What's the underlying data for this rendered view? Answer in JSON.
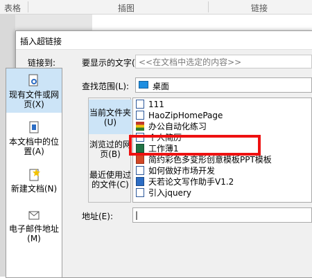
{
  "header": {
    "col1": "表格",
    "col2": "插图",
    "col3": "链接"
  },
  "dialog": {
    "title": "插入超链接",
    "link_to_label": "链接到:",
    "display_text_label": "要显示的文字(T):",
    "display_text_value": "<<在文档中选定的内容>>",
    "look_in_label": "查找范围(L):",
    "look_in_value": "桌面",
    "address_label": "地址(E):",
    "address_value": "|"
  },
  "left_panel": {
    "items": [
      {
        "label": "现有文件或网页(X)"
      },
      {
        "label": "本文档中的位置(A)"
      },
      {
        "label": "新建文档(N)"
      },
      {
        "label": "电子邮件地址(M)"
      }
    ]
  },
  "nav": {
    "items": [
      {
        "label": "当前文件夹(U)"
      },
      {
        "label": "浏览过的网页(B)"
      },
      {
        "label": "最近使用过的文件(C)"
      }
    ]
  },
  "files": [
    {
      "name": "111",
      "icon": "word-doc-icon"
    },
    {
      "name": "HaoZipHomePage",
      "icon": "word-doc-icon"
    },
    {
      "name": "办公自动化练习",
      "icon": "folder-archive-icon"
    },
    {
      "name": "个人简历",
      "icon": "word-doc-icon"
    },
    {
      "name": "工作薄1",
      "icon": "excel-icon"
    },
    {
      "name": "简约彩色多变形创意模板PPT模板",
      "icon": "ppt-icon"
    },
    {
      "name": "如何做好市场开发",
      "icon": "word-doc-icon"
    },
    {
      "name": "天若论文写作助手V1.2",
      "icon": "app-icon"
    },
    {
      "name": "引入jquery",
      "icon": "word-doc-icon"
    }
  ],
  "colors": {
    "highlight_red": "#ee1111",
    "selection": "#cce4f7"
  }
}
